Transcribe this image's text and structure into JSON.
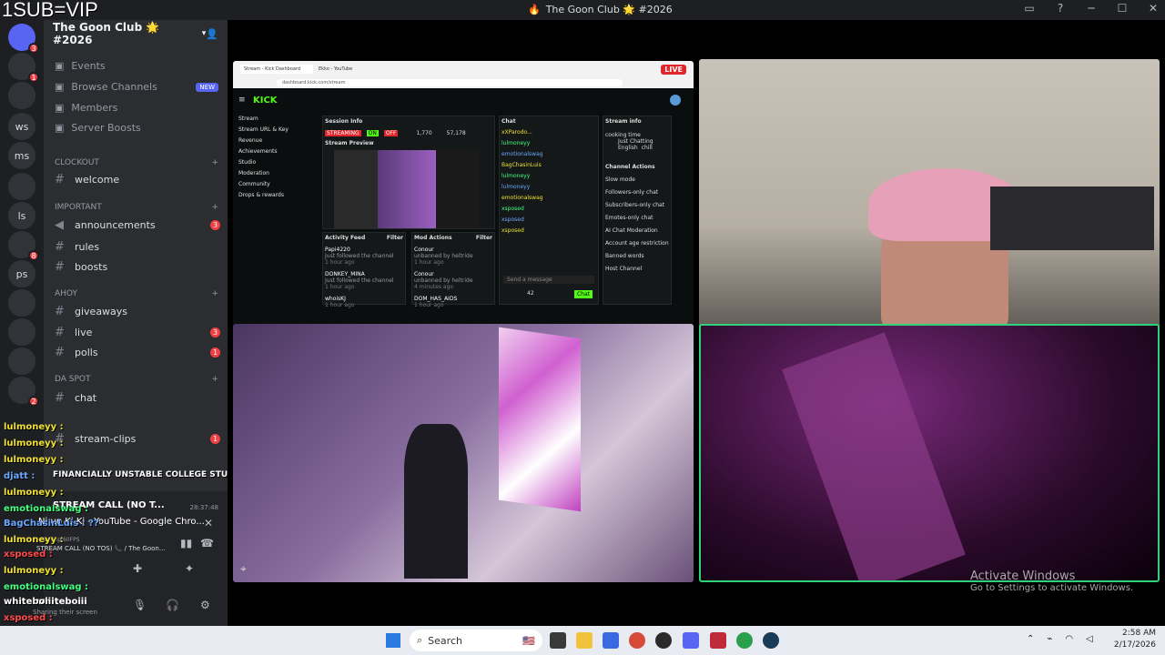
{
  "overlay": {
    "tag": "1SUB=VIP"
  },
  "window": {
    "title": "The Goon Club 🌟 #2026"
  },
  "server": {
    "name": "The Goon Club 🌟 #2026"
  },
  "nav": [
    {
      "label": "Events"
    },
    {
      "label": "Browse Channels",
      "badge": "NEW"
    },
    {
      "label": "Members"
    },
    {
      "label": "Server Boosts"
    }
  ],
  "categories": {
    "clockout": "CLOCKOUT",
    "important": "IMPORTANT",
    "ahoy": "AHOY",
    "daspot": "DA SPOT"
  },
  "channels": [
    {
      "name": "welcome",
      "badge": ""
    },
    {
      "name": "announcements",
      "badge": "3"
    },
    {
      "name": "rules",
      "badge": ""
    },
    {
      "name": "boosts",
      "badge": ""
    },
    {
      "name": "giveaways",
      "badge": ""
    },
    {
      "name": "live",
      "badge": "3"
    },
    {
      "name": "polls",
      "badge": "1"
    },
    {
      "name": "chat",
      "badge": ""
    },
    {
      "name": "stream-clips",
      "badge": "1"
    }
  ],
  "guilds": [
    {
      "label": "",
      "badge": "3"
    },
    {
      "label": "",
      "badge": "1"
    },
    {
      "label": "",
      "badge": ""
    },
    {
      "label": "ws",
      "badge": ""
    },
    {
      "label": "ms",
      "badge": ""
    },
    {
      "label": "",
      "badge": ""
    },
    {
      "label": "ls",
      "badge": ""
    },
    {
      "label": "",
      "badge": "8"
    },
    {
      "label": "ps",
      "badge": ""
    },
    {
      "label": "",
      "badge": ""
    },
    {
      "label": "",
      "badge": ""
    },
    {
      "label": "",
      "badge": ""
    },
    {
      "label": "",
      "badge": "2"
    }
  ],
  "chat_overlay": [
    {
      "user": "lulmoneyy :",
      "cls": "u-y"
    },
    {
      "user": "lulmoneyy :",
      "cls": "u-y"
    },
    {
      "user": "lulmoneyy :",
      "cls": "u-y"
    },
    {
      "user": "djatt :",
      "cls": "u-b"
    },
    {
      "user": "lulmoneyy :",
      "cls": "u-y"
    },
    {
      "user": "emotionalswag :",
      "cls": "u-g"
    },
    {
      "user": "BagChasinLuis : ??",
      "cls": "u-b"
    },
    {
      "user": "lulmoneyy :",
      "cls": "u-y"
    },
    {
      "user": "xsposed :",
      "cls": "u-r"
    },
    {
      "user": "lulmoneyy :",
      "cls": "u-y"
    },
    {
      "user": "emotionalswag :",
      "cls": "u-g"
    },
    {
      "user": "whiteboiii",
      "cls": "u-w"
    },
    {
      "user": "xsposed :",
      "cls": "u-r"
    }
  ],
  "voice": {
    "stream_title": "STREAM CALL (NO T...",
    "duration": "28:37:48",
    "status_title": "FINANCIALLY UNSTABLE COLLEGE STUDENT PC SETUP",
    "tab_title": "Ni up Ki Ki - YouTube - Google Chro...",
    "quality": "1440p 60FPS",
    "channel_line": "STREAM CALL (NO TOS) 📞 / The Goon...",
    "user": "whiteboiii",
    "user_status": "Sharing their screen"
  },
  "kick": {
    "live_tag": "LIVE",
    "tab1": "Stream - Kick Dashboard",
    "tab2": "Ekko - YouTube",
    "url": "dashboard.kick.com/stream",
    "logo": "KICK",
    "sidebar": [
      "Stream",
      "Stream URL & Key",
      "Revenue",
      "Achievements",
      "Studio",
      "Moderation",
      "Community",
      "Drops & rewards"
    ],
    "session_info": "Session Info",
    "stream_preview": "Stream Preview",
    "streaming_label": "STREAMING",
    "on": "ON",
    "off": "OFF",
    "viewers": "1,770",
    "followers": "57,178",
    "chat_label": "Chat",
    "stream_info": "Stream info",
    "stream_title": "cooking time",
    "category": "Just Chatting",
    "tags": [
      "English",
      "chill"
    ],
    "channel_actions": "Channel Actions",
    "actions": [
      "Slow mode",
      "Followers-only chat",
      "Subscribers-only chat",
      "Emotes-only chat",
      "AI Chat Moderation",
      "Account age restriction",
      "Banned words",
      "Host Channel"
    ],
    "activity_feed": "Activity Feed",
    "mod_actions": "Mod Actions",
    "filter": "Filter",
    "activity": [
      {
        "user": "Papi4220",
        "text": "Just followed the channel",
        "time": "1 hour ago"
      },
      {
        "user": "DONKEY_MINA",
        "text": "Just followed the channel",
        "time": "1 hour ago"
      },
      {
        "user": "whoisKJ",
        "text": "",
        "time": "1 hour ago"
      }
    ],
    "mods": [
      {
        "user": "Conour",
        "text": "unbanned by heltride",
        "time": "1 hour ago"
      },
      {
        "user": "Conour",
        "text": "unbanned by heltride",
        "time": "4 minutes ago"
      },
      {
        "user": "DOM_HAS_AIDS",
        "text": "",
        "time": "1 hour ago"
      }
    ],
    "chat_users": [
      "xXParodo...",
      "lulmoneyy",
      "emotionalswag",
      "BagChasinLuis",
      "lulmoneyy",
      "lulmoneyy",
      "emotionalswag",
      "xsposed",
      "xsposed",
      "xsposed"
    ],
    "send_placeholder": "Send a message",
    "chat_btn": "Chat",
    "count": "42"
  },
  "windows_watermark": {
    "line1": "Activate Windows",
    "line2": "Go to Settings to activate Windows."
  },
  "taskbar": {
    "search": "Search",
    "time": "2:58 AM",
    "date": "2/17/2026"
  }
}
